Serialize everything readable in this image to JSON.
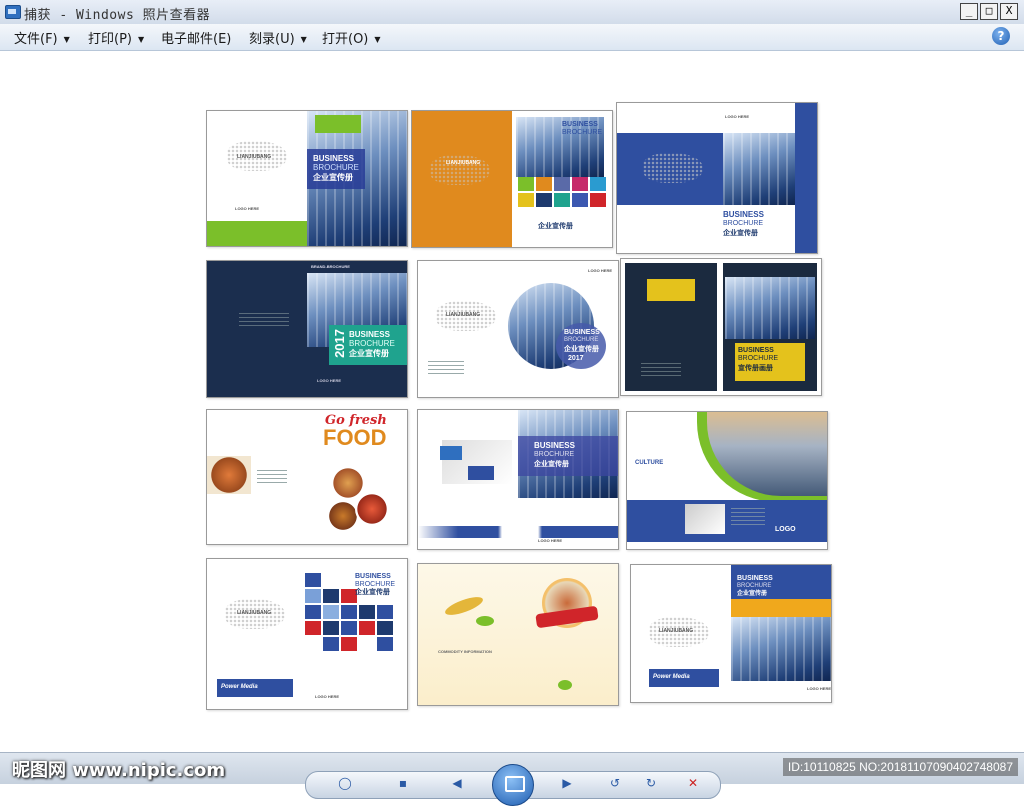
{
  "window": {
    "title": "捕获 - Windows 照片查看器",
    "min": "_",
    "max": "□",
    "close": "X"
  },
  "menu": [
    {
      "label": "文件(F)",
      "has_caret": true
    },
    {
      "label": "打印(P)",
      "has_caret": true
    },
    {
      "label": "电子邮件(E)",
      "has_caret": false
    },
    {
      "label": "刻录(U)",
      "has_caret": true
    },
    {
      "label": "打开(O)",
      "has_caret": true
    }
  ],
  "help": "?",
  "thumbs": {
    "t1": {
      "logo": "LOGO HERE",
      "brand": "LIANJIUBANG",
      "line1": "BUSINESS",
      "line2": "BROCHURE",
      "cn": "企业宣传册"
    },
    "t2": {
      "brand": "LIANJIUBANG",
      "cn": "企业宣传册",
      "line1": "BUSINESS",
      "line2": "BROCHURE"
    },
    "t3": {
      "logo": "LOGO HERE",
      "line1": "BUSINESS",
      "line2": "BROCHURE",
      "cn": "企业宣传册"
    },
    "t4": {
      "top": "BRAND-BROCHURE",
      "year": "2017",
      "line1": "BUSINESS",
      "line2": "BROCHURE",
      "cn": "企业宣传册",
      "logo": "LOGO HERE"
    },
    "t5": {
      "logo": "LOGO HERE",
      "brand": "LIANJIUBANG",
      "line1": "BUSINESS",
      "line2": "BROCHURE",
      "cn": "企业宣传册",
      "year": "2017"
    },
    "t6": {
      "line1": "BUSINESS",
      "line2": "BROCHURE",
      "cn": "宣传册画册",
      "logo": "LOGO HERE"
    },
    "t7": {
      "script": "Go fresh",
      "food": "FOOD"
    },
    "t8": {
      "line1": "BUSINESS",
      "line2": "BROCHURE",
      "cn": "企业宣传册",
      "logo": "LOGO HERE"
    },
    "t9": {
      "title": "CULTURE",
      "logo": "LOGO"
    },
    "t10": {
      "brand": "LIANJIUBANG",
      "line1": "BUSINESS",
      "line2": "BROCHURE",
      "cn": "企业宣传册",
      "pm": "Power Media",
      "logo": "LOGO HERE"
    },
    "t11": {
      "title": "COMMODITY INFORMATION"
    },
    "t12": {
      "line1": "BUSINESS",
      "line2": "BROCHURE",
      "cn": "企业宣传册",
      "brand": "LIANJIUBANG",
      "pm": "Power Media",
      "logo": "LOGO HERE"
    }
  },
  "status": {
    "watermark": "昵图网 www.nipic.com",
    "id_label": "ID:10110825 NO:20181107090402748087"
  },
  "colors": {
    "navy": "#1e3a6e",
    "blue": "#2f4fa0",
    "green": "#7bbf2a",
    "orange": "#e08a1e",
    "teal": "#1fa38e",
    "yellow": "#e4c21c",
    "red": "#d0252a"
  }
}
